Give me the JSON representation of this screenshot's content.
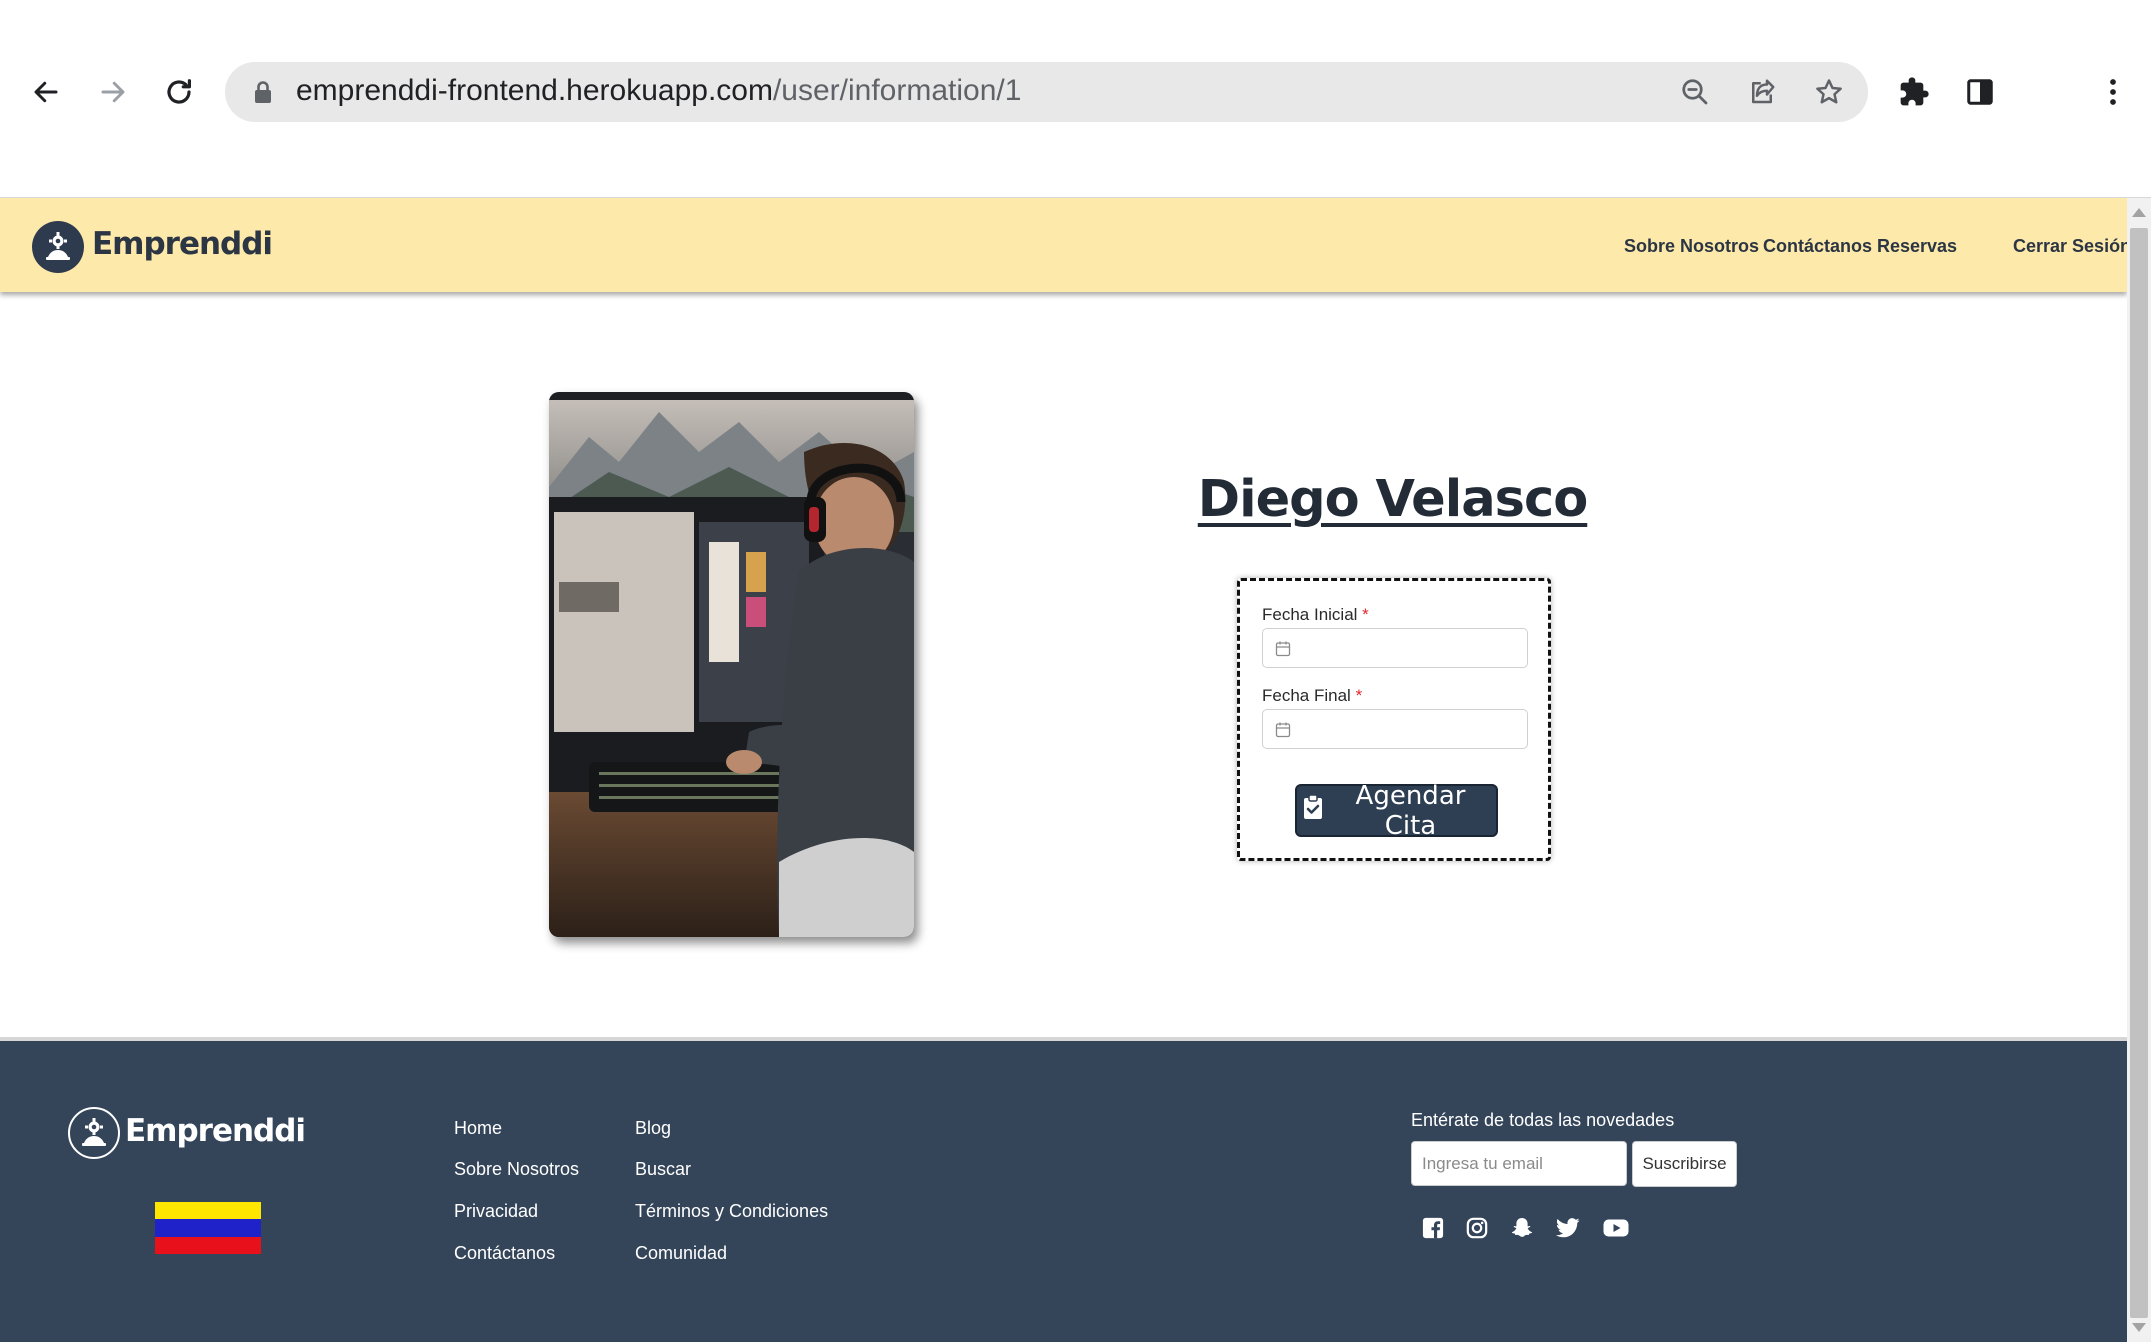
{
  "browser": {
    "url_host": "emprenddi-frontend.herokuapp.com",
    "url_path": "/user/information/1",
    "icons": [
      "back-icon",
      "forward-icon",
      "reload-icon",
      "lock-icon",
      "zoom-out-icon",
      "share-icon",
      "star-icon",
      "extensions-icon",
      "sidepanel-icon",
      "kebab-menu-icon"
    ]
  },
  "header": {
    "logo_text": "Emprenddi",
    "menu": [
      {
        "label": "Sobre Nosotros"
      },
      {
        "label": "Contáctanos"
      },
      {
        "label": "Reservas"
      },
      {
        "label": "Cerrar Sesión"
      }
    ]
  },
  "profile": {
    "name": "Diego Velasco",
    "photo_icon": "person-at-computer-photo"
  },
  "booking_form": {
    "start_label": "Fecha Inicial",
    "end_label": "Fecha Final",
    "required_mark": "*",
    "start_value": "",
    "end_value": "",
    "submit_label": "Agendar Cita",
    "submit_icon": "clipboard-check-icon"
  },
  "footer": {
    "logo_text": "Emprenddi",
    "links_col1": [
      {
        "label": "Home"
      },
      {
        "label": "Sobre Nosotros"
      },
      {
        "label": "Privacidad"
      },
      {
        "label": "Contáctanos"
      }
    ],
    "links_col2": [
      {
        "label": "Blog"
      },
      {
        "label": "Buscar"
      },
      {
        "label": "Términos y Condiciones"
      },
      {
        "label": "Comunidad"
      }
    ],
    "newsletter_label": "Entérate de todas las novedades",
    "email_placeholder": "Ingresa tu email",
    "subscribe_label": "Suscribirse",
    "social": [
      "facebook-icon",
      "instagram-icon",
      "snapchat-icon",
      "twitter-icon",
      "youtube-icon"
    ],
    "flag_colors": [
      "#ffe600",
      "#1e22c8",
      "#e8101a"
    ]
  },
  "colors": {
    "header_bg": "#fde9a9",
    "footer_bg": "#344559",
    "button_bg": "#2e3e53",
    "text_dark": "#222b36"
  }
}
